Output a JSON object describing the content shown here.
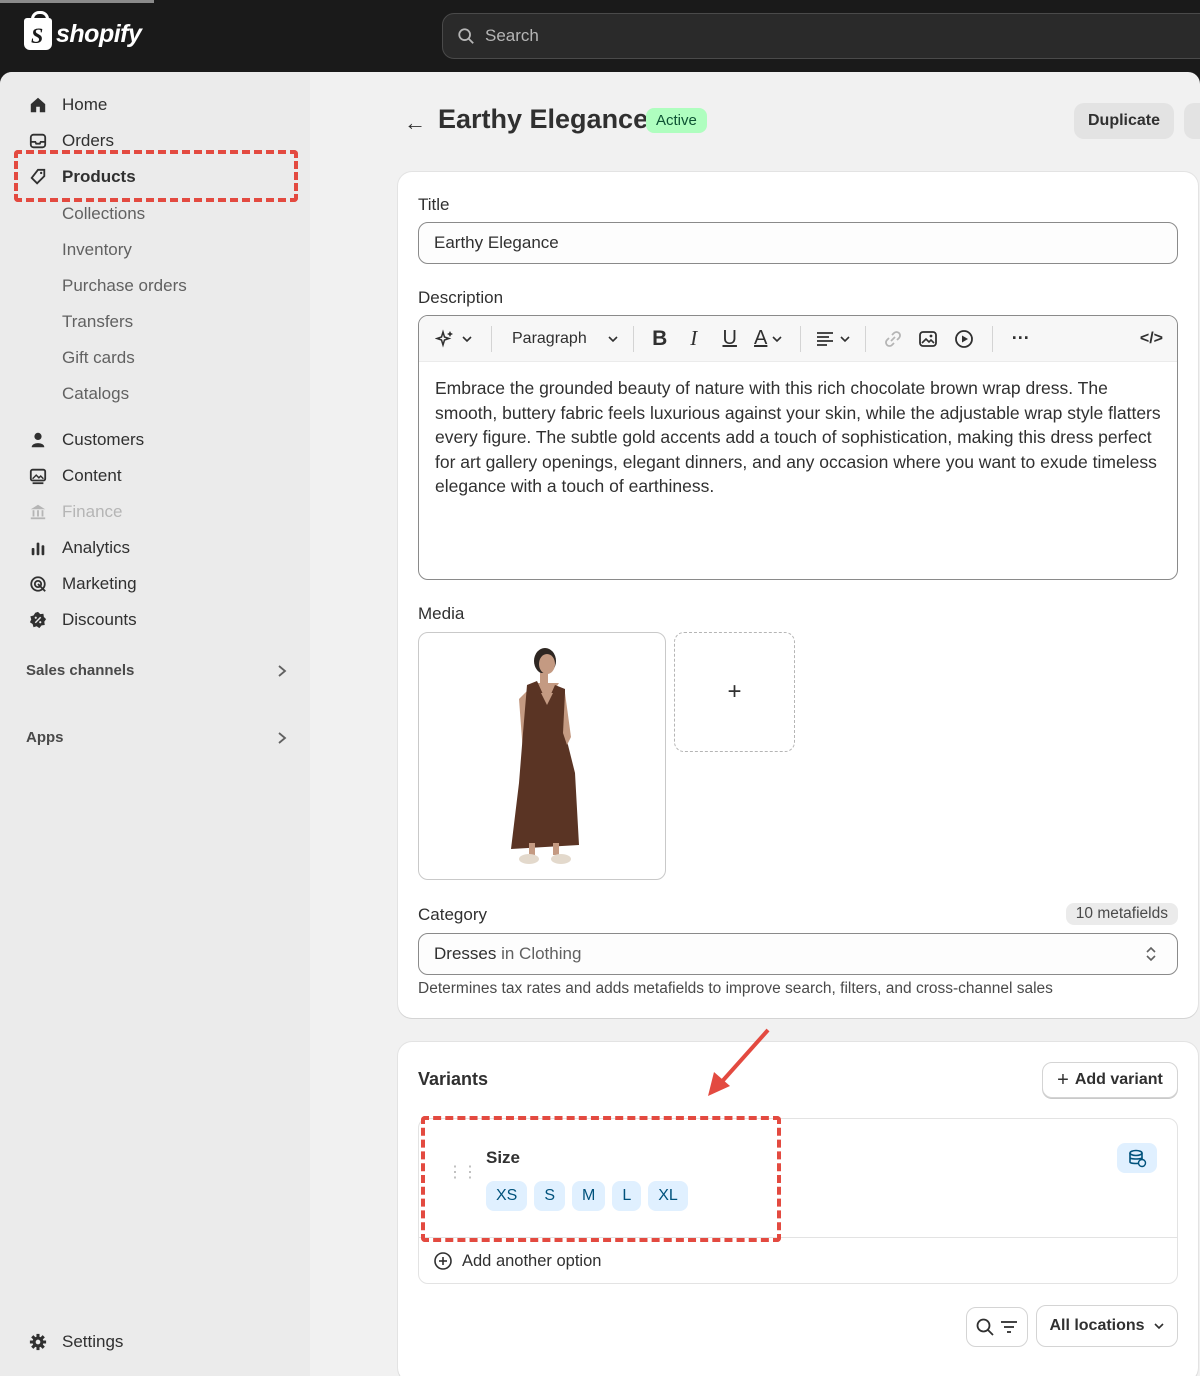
{
  "brand": {
    "name": "shopify"
  },
  "search": {
    "placeholder": "Search"
  },
  "sidebar": {
    "items": [
      {
        "label": "Home",
        "icon": "home-icon"
      },
      {
        "label": "Orders",
        "icon": "inbox-icon"
      },
      {
        "label": "Products",
        "icon": "tag-icon"
      },
      {
        "label": "Customers",
        "icon": "person-icon"
      },
      {
        "label": "Content",
        "icon": "image-icon"
      },
      {
        "label": "Finance",
        "icon": "bank-icon"
      },
      {
        "label": "Analytics",
        "icon": "bar-chart-icon"
      },
      {
        "label": "Marketing",
        "icon": "target-icon"
      },
      {
        "label": "Discounts",
        "icon": "discount-icon"
      },
      {
        "label": "Settings",
        "icon": "gear-icon"
      }
    ],
    "product_subitems": [
      "Collections",
      "Inventory",
      "Purchase orders",
      "Transfers",
      "Gift cards",
      "Catalogs"
    ],
    "sections": {
      "sales_channels": "Sales channels",
      "apps": "Apps"
    }
  },
  "header": {
    "title": "Earthy Elegance",
    "status": "Active",
    "duplicate_label": "Duplicate"
  },
  "form": {
    "title_label": "Title",
    "title_value": "Earthy Elegance",
    "description_label": "Description",
    "toolbar": {
      "paragraph": "Paragraph"
    },
    "description_text": "Embrace the grounded beauty of nature with this rich chocolate brown wrap dress. The smooth, buttery fabric feels luxurious against your skin, while the adjustable wrap style flatters every figure. The subtle gold accents add a touch of sophistication, making this dress perfect for art gallery openings, elegant dinners, and any occasion where you want to exude timeless elegance with a touch of earthiness.",
    "media_label": "Media",
    "category_label": "Category",
    "metafields": "10 metafields",
    "category_value": "Dresses",
    "category_suffix": " in Clothing",
    "category_help": "Determines tax rates and adds metafields to improve search, filters, and cross-channel sales"
  },
  "variants": {
    "title": "Variants",
    "add_variant": "Add variant",
    "option_name": "Size",
    "values": [
      "XS",
      "S",
      "M",
      "L",
      "XL"
    ],
    "add_option": "Add another option",
    "locations": "All locations"
  },
  "colors": {
    "accent_active": "#affebf",
    "annotation": "#e34a40",
    "chip": "#e0f0ff"
  }
}
